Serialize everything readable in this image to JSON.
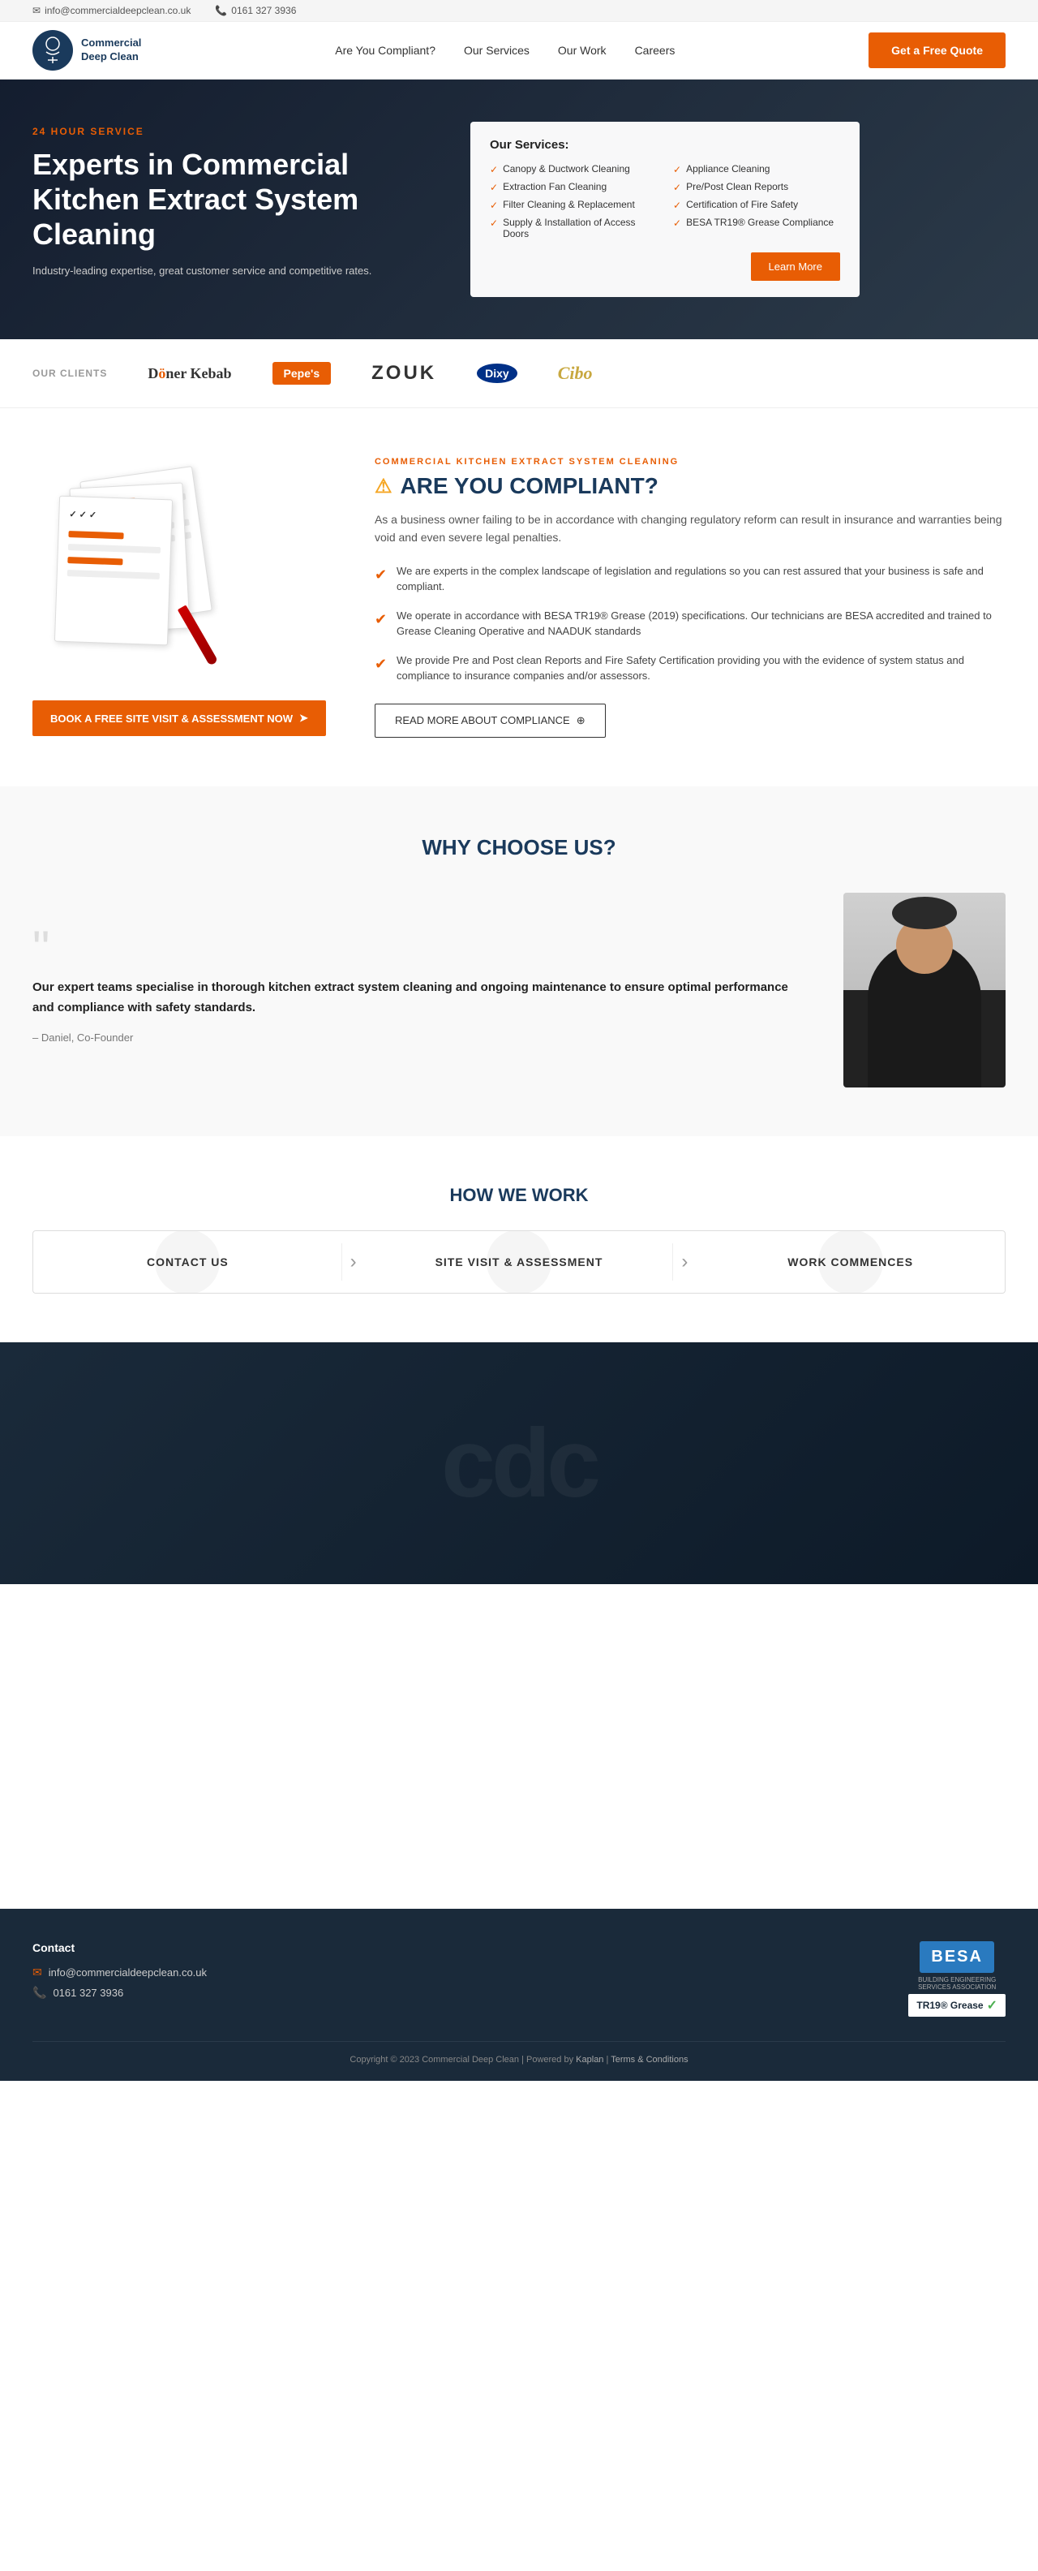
{
  "topbar": {
    "email": "info@commercialdeepclean.co.uk",
    "phone": "0161 327 3936"
  },
  "header": {
    "logo_text": "Commercial\nDeep Clean",
    "nav": [
      {
        "label": "Are You Compliant?"
      },
      {
        "label": "Our Services"
      },
      {
        "label": "Our Work"
      },
      {
        "label": "Careers"
      }
    ],
    "cta_label": "Get a Free Quote"
  },
  "hero": {
    "service_tag": "24 HOUR SERVICE",
    "title": "Experts in Commercial Kitchen Extract System Cleaning",
    "subtitle": "Industry-leading expertise, great customer service and competitive rates.",
    "services_card": {
      "heading": "Our Services:",
      "items": [
        "Canopy & Ductwork Cleaning",
        "Appliance Cleaning",
        "Extraction Fan Cleaning",
        "Pre/Post Clean Reports",
        "Filter Cleaning & Replacement",
        "Certification of Fire Safety",
        "Supply & Installation of Access Doors",
        "BESA TR19® Grease Compliance"
      ],
      "cta_label": "Learn More"
    }
  },
  "clients": {
    "label": "OUR CLIENTS",
    "logos": [
      {
        "name": "Döner Kebab",
        "style": "doner"
      },
      {
        "name": "Pepe's",
        "style": "pepes"
      },
      {
        "name": "ZOUK",
        "style": "zouk"
      },
      {
        "name": "Dixy",
        "style": "dixy"
      },
      {
        "name": "Cibo",
        "style": "cibo"
      }
    ]
  },
  "compliance": {
    "section_tag": "COMMERCIAL KITCHEN EXTRACT SYSTEM CLEANING",
    "title": "ARE YOU COMPLIANT?",
    "description": "As a business owner failing to be in accordance with changing regulatory reform can result in insurance and warranties being void and even severe legal penalties.",
    "points": [
      "We are experts in the complex landscape of legislation and regulations so you can rest assured that your business is safe and compliant.",
      "We operate in accordance with BESA TR19® Grease (2019) specifications. Our technicians are BESA accredited and trained to Grease Cleaning Operative and NAADUK standards",
      "We provide Pre and Post clean Reports and Fire Safety Certification providing you with the evidence of system status and compliance to insurance companies and/or assessors."
    ],
    "book_btn": "BOOK A FREE SITE VISIT & ASSESSMENT NOW",
    "read_more_btn": "READ MORE ABOUT COMPLIANCE"
  },
  "why": {
    "heading": "WHY CHOOSE US?",
    "quote": "Our expert teams specialise in thorough kitchen extract system cleaning and ongoing maintenance to ensure optimal performance and compliance with safety standards.",
    "author": "– Daniel, Co-Founder"
  },
  "how": {
    "heading": "HOW WE WORK",
    "steps": [
      {
        "label": "CONTACT US"
      },
      {
        "label": "SITE VISIT & ASSESSMENT"
      },
      {
        "label": "WORK COMMENCES"
      }
    ]
  },
  "footer": {
    "contact_heading": "Contact",
    "email": "info@commercialdeepclean.co.uk",
    "phone": "0161 327 3936",
    "copyright": "Copyright © 2023 Commercial Deep Clean | Powered by",
    "powered_by": "Kaplan",
    "terms": "Terms & Conditions",
    "besa_label": "BESA",
    "besa_sub": "BUILDING ENGINEERING\nSERVICES ASSOCIATION",
    "tr19_label": "TR19® Grease"
  }
}
